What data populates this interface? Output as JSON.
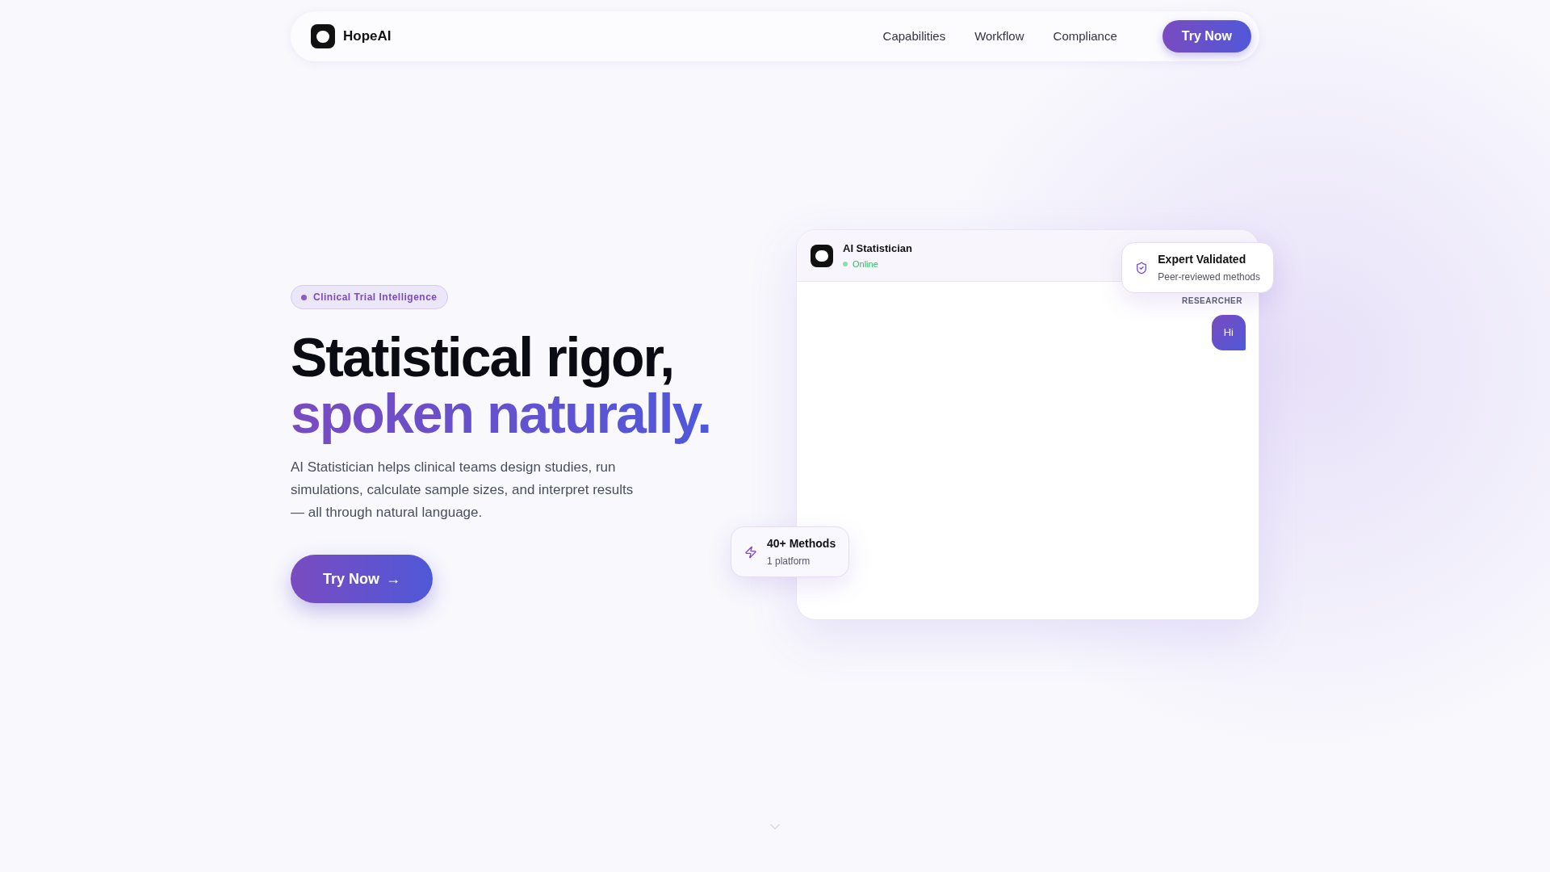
{
  "nav": {
    "brand": "HopeAI",
    "links": [
      "Capabilities",
      "Workflow",
      "Compliance"
    ],
    "cta": "Try Now"
  },
  "hero": {
    "badge": "Clinical Trial Intelligence",
    "title_line_1": "Statistical rigor,",
    "title_line_2": "spoken naturally.",
    "description": "AI Statistician helps clinical teams design studies, run simulations, calculate sample sizes, and interpret results — all through natural language.",
    "cta": "Try Now",
    "cta_arrow": "→"
  },
  "chat": {
    "name": "AI Statistician",
    "status": "Online",
    "messages": [
      {
        "role": "RESEARCHER",
        "text": "Hi"
      }
    ]
  },
  "floating": [
    {
      "kind": "shield",
      "title": "Expert Validated",
      "subtitle": "Peer-reviewed methods"
    },
    {
      "kind": "bolt",
      "title": "40+ Methods",
      "subtitle": "1 platform"
    }
  ]
}
